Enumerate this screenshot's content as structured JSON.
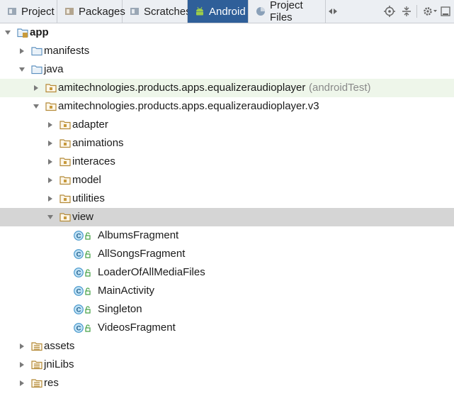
{
  "tabs": [
    {
      "label": "Project",
      "icon": "project-icon",
      "active": false
    },
    {
      "label": "Packages",
      "icon": "packages-icon",
      "active": false
    },
    {
      "label": "Scratches",
      "icon": "scratches-icon",
      "active": false
    },
    {
      "label": "Android",
      "icon": "android-icon",
      "active": true
    },
    {
      "label": "Project Files",
      "icon": "project-files-icon",
      "active": false
    }
  ],
  "toolbar_icons": [
    "scroll-tabs-icon",
    "target-icon",
    "collapse-all-icon",
    "settings-icon",
    "hide-icon"
  ],
  "tree": [
    {
      "label": "app",
      "icon": "module-folder-icon",
      "expanded": true
    },
    {
      "label": "manifests",
      "icon": "folder-icon",
      "expanded": false
    },
    {
      "label": "java",
      "icon": "folder-icon",
      "expanded": true
    },
    {
      "label": "amitechnologies.products.apps.equalizeraudioplayer",
      "suffix": "(androidTest)",
      "icon": "package-icon",
      "expanded": false
    },
    {
      "label": "amitechnologies.products.apps.equalizeraudioplayer.v3",
      "icon": "package-icon",
      "expanded": true
    },
    {
      "label": "adapter",
      "icon": "package-icon",
      "expanded": false
    },
    {
      "label": "animations",
      "icon": "package-icon",
      "expanded": false
    },
    {
      "label": "interaces",
      "icon": "package-icon",
      "expanded": false
    },
    {
      "label": "model",
      "icon": "package-icon",
      "expanded": false
    },
    {
      "label": "utilities",
      "icon": "package-icon",
      "expanded": false
    },
    {
      "label": "view",
      "icon": "package-icon",
      "expanded": true,
      "selected": true
    },
    {
      "label": "AlbumsFragment",
      "icon": "class-icon"
    },
    {
      "label": "AllSongsFragment",
      "icon": "class-icon"
    },
    {
      "label": "LoaderOfAllMediaFiles",
      "icon": "class-icon"
    },
    {
      "label": "MainActivity",
      "icon": "class-icon"
    },
    {
      "label": "Singleton",
      "icon": "class-icon"
    },
    {
      "label": "VideosFragment",
      "icon": "class-icon"
    },
    {
      "label": "assets",
      "icon": "resource-folder-icon",
      "expanded": false
    },
    {
      "label": "jniLibs",
      "icon": "resource-folder-icon",
      "expanded": false
    },
    {
      "label": "res",
      "icon": "resource-folder-icon",
      "expanded": false
    }
  ],
  "colors": {
    "active_tab": "#2f5f99",
    "selected_row": "#d5d5d5",
    "test_row": "#eef6ea",
    "folder": "#5a8fbf",
    "package": "#c89a3c",
    "class_circle": "#3f93c9"
  }
}
